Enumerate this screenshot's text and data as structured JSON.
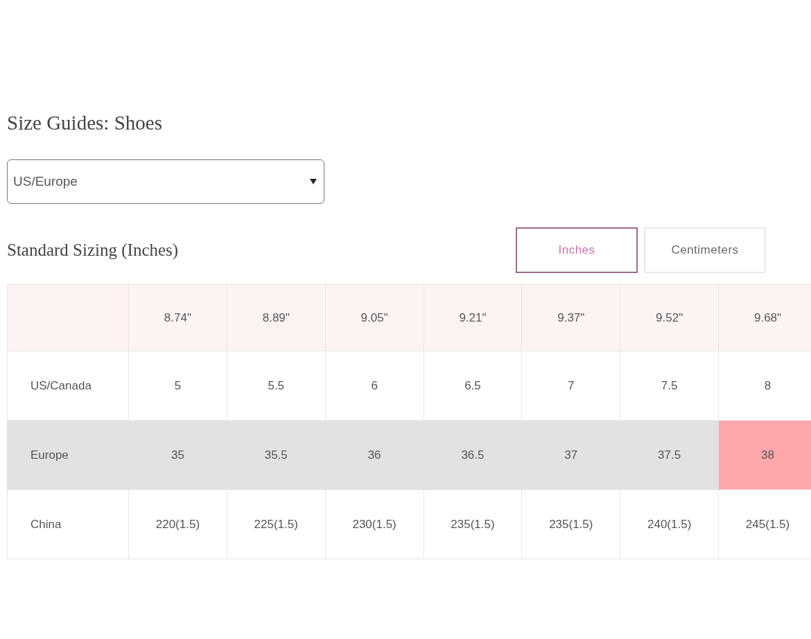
{
  "title": "Size Guides: Shoes",
  "region_select": {
    "value": "US/Europe"
  },
  "section_title": "Standard Sizing (Inches)",
  "unit_toggle": [
    {
      "label": "Inches",
      "selected": true
    },
    {
      "label": "Centimeters",
      "selected": false
    }
  ],
  "table": {
    "rows": [
      {
        "kind": "header",
        "highlighted": false,
        "cells": [
          {
            "text": "8.74\"",
            "highlighted": false
          },
          {
            "text": "8.89\"",
            "highlighted": false
          },
          {
            "text": "9.05\"",
            "highlighted": false
          },
          {
            "text": "9.21\"",
            "highlighted": false
          },
          {
            "text": "9.37\"",
            "highlighted": false
          },
          {
            "text": "9.52\"",
            "highlighted": false
          },
          {
            "text": "9.68\"",
            "highlighted": false
          }
        ]
      },
      {
        "kind": "body",
        "label": "US/Canada",
        "highlighted": false,
        "cells": [
          {
            "text": "5",
            "highlighted": false
          },
          {
            "text": "5.5",
            "highlighted": false
          },
          {
            "text": "6",
            "highlighted": false
          },
          {
            "text": "6.5",
            "highlighted": false
          },
          {
            "text": "7",
            "highlighted": false
          },
          {
            "text": "7.5",
            "highlighted": false
          },
          {
            "text": "8",
            "highlighted": false
          }
        ]
      },
      {
        "kind": "body",
        "label": "Europe",
        "highlighted": true,
        "cells": [
          {
            "text": "35",
            "highlighted": false
          },
          {
            "text": "35.5",
            "highlighted": false
          },
          {
            "text": "36",
            "highlighted": false
          },
          {
            "text": "36.5",
            "highlighted": false
          },
          {
            "text": "37",
            "highlighted": false
          },
          {
            "text": "37.5",
            "highlighted": false
          },
          {
            "text": "38",
            "highlighted": true
          }
        ]
      },
      {
        "kind": "body",
        "label": "China",
        "highlighted": false,
        "cells": [
          {
            "text": "220(1.5)",
            "highlighted": false
          },
          {
            "text": "225(1.5)",
            "highlighted": false
          },
          {
            "text": "230(1.5)",
            "highlighted": false
          },
          {
            "text": "235(1.5)",
            "highlighted": false
          },
          {
            "text": "235(1.5)",
            "highlighted": false
          },
          {
            "text": "240(1.5)",
            "highlighted": false
          },
          {
            "text": "245(1.5)",
            "highlighted": false
          }
        ]
      }
    ]
  }
}
